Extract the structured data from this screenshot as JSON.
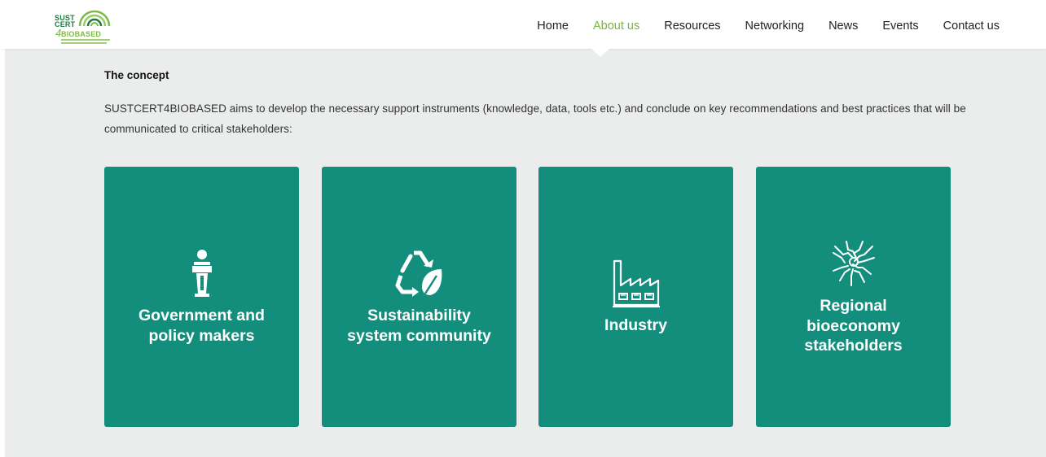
{
  "brand": {
    "logo_line1": "SUST",
    "logo_line2": "CERT",
    "logo_digit": "4",
    "logo_line3": "BIOBASED",
    "colors": {
      "dark_green": "#1f7a3f",
      "light_green": "#7dbb42"
    }
  },
  "nav": {
    "items": [
      {
        "label": "Home",
        "active": false
      },
      {
        "label": "About us",
        "active": true
      },
      {
        "label": "Resources",
        "active": false
      },
      {
        "label": "Networking",
        "active": false
      },
      {
        "label": "News",
        "active": false
      },
      {
        "label": "Events",
        "active": false
      },
      {
        "label": "Contact us",
        "active": false
      }
    ],
    "active_color": "#7cb342"
  },
  "concept": {
    "title": "The concept",
    "intro": "SUSTCERT4BIOBASED aims to develop the necessary support instruments (knowledge, data, tools etc.)  and conclude on key recommendations and best practices that will be communicated to critical stakeholders:"
  },
  "cards": [
    {
      "label": "Government and\npolicy makers",
      "icon": "podium-speaker-icon"
    },
    {
      "label": "Sustainability\nsystem community",
      "icon": "recycle-leaf-icon"
    },
    {
      "label": "Industry",
      "icon": "factory-icon"
    },
    {
      "label": "Regional\nbioeconomy\nstakeholders",
      "icon": "joined-hands-icon"
    }
  ],
  "colors": {
    "card_bg": "#138e7d",
    "page_bg": "#ebecec"
  }
}
